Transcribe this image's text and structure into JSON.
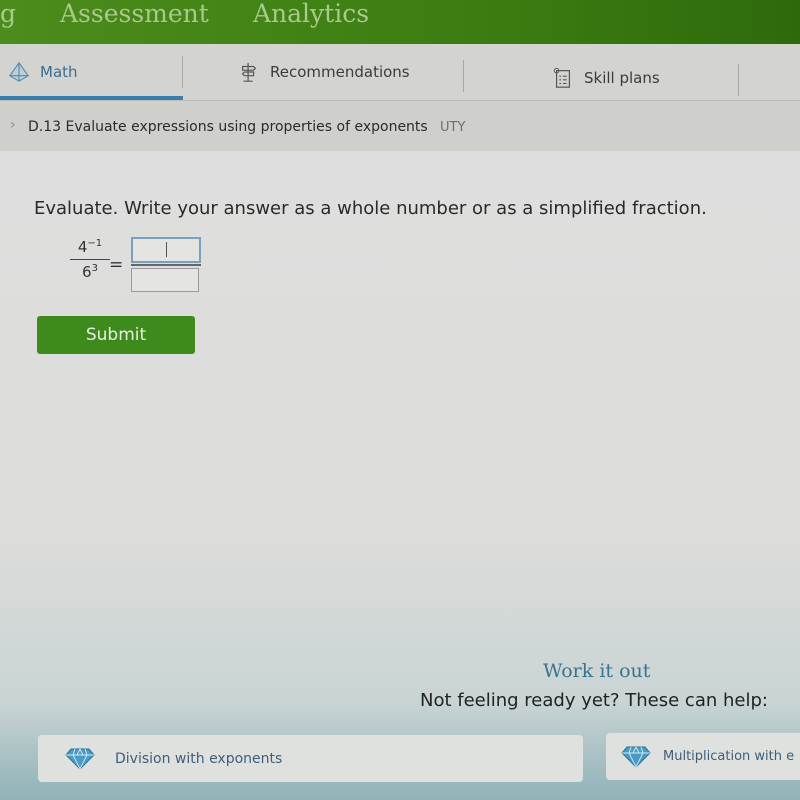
{
  "top_nav": {
    "items": [
      {
        "label": "g"
      },
      {
        "label": "Assessment"
      },
      {
        "label": "Analytics"
      }
    ]
  },
  "tabs": [
    {
      "label": "Math",
      "icon": "pyramid-icon",
      "active": true
    },
    {
      "label": "Recommendations",
      "icon": "signpost-icon",
      "active": false
    },
    {
      "label": "Skill plans",
      "icon": "clipboard-list-icon",
      "active": false
    }
  ],
  "breadcrumb": {
    "arrow": "›",
    "skill_title": "D.13 Evaluate expressions using properties of exponents",
    "skill_code": "UTY"
  },
  "question": {
    "prompt": "Evaluate. Write your answer as a whole number or as a simplified fraction.",
    "numerator_base": "4",
    "numerator_exp": "−1",
    "denominator_base": "6",
    "denominator_exp": "3",
    "equals": "=",
    "answer_numerator": "",
    "answer_denominator": ""
  },
  "submit_label": "Submit",
  "help": {
    "heading": "Work it out",
    "subheading": "Not feeling ready yet? These can help:",
    "cards": [
      {
        "label": "Division with exponents",
        "icon": "diamond-icon"
      },
      {
        "label": "Multiplication with e",
        "icon": "diamond-icon"
      }
    ]
  },
  "colors": {
    "brand_green": "#3b7d12",
    "active_tab_blue": "#3a7dad",
    "link_blue": "#3a7391"
  }
}
